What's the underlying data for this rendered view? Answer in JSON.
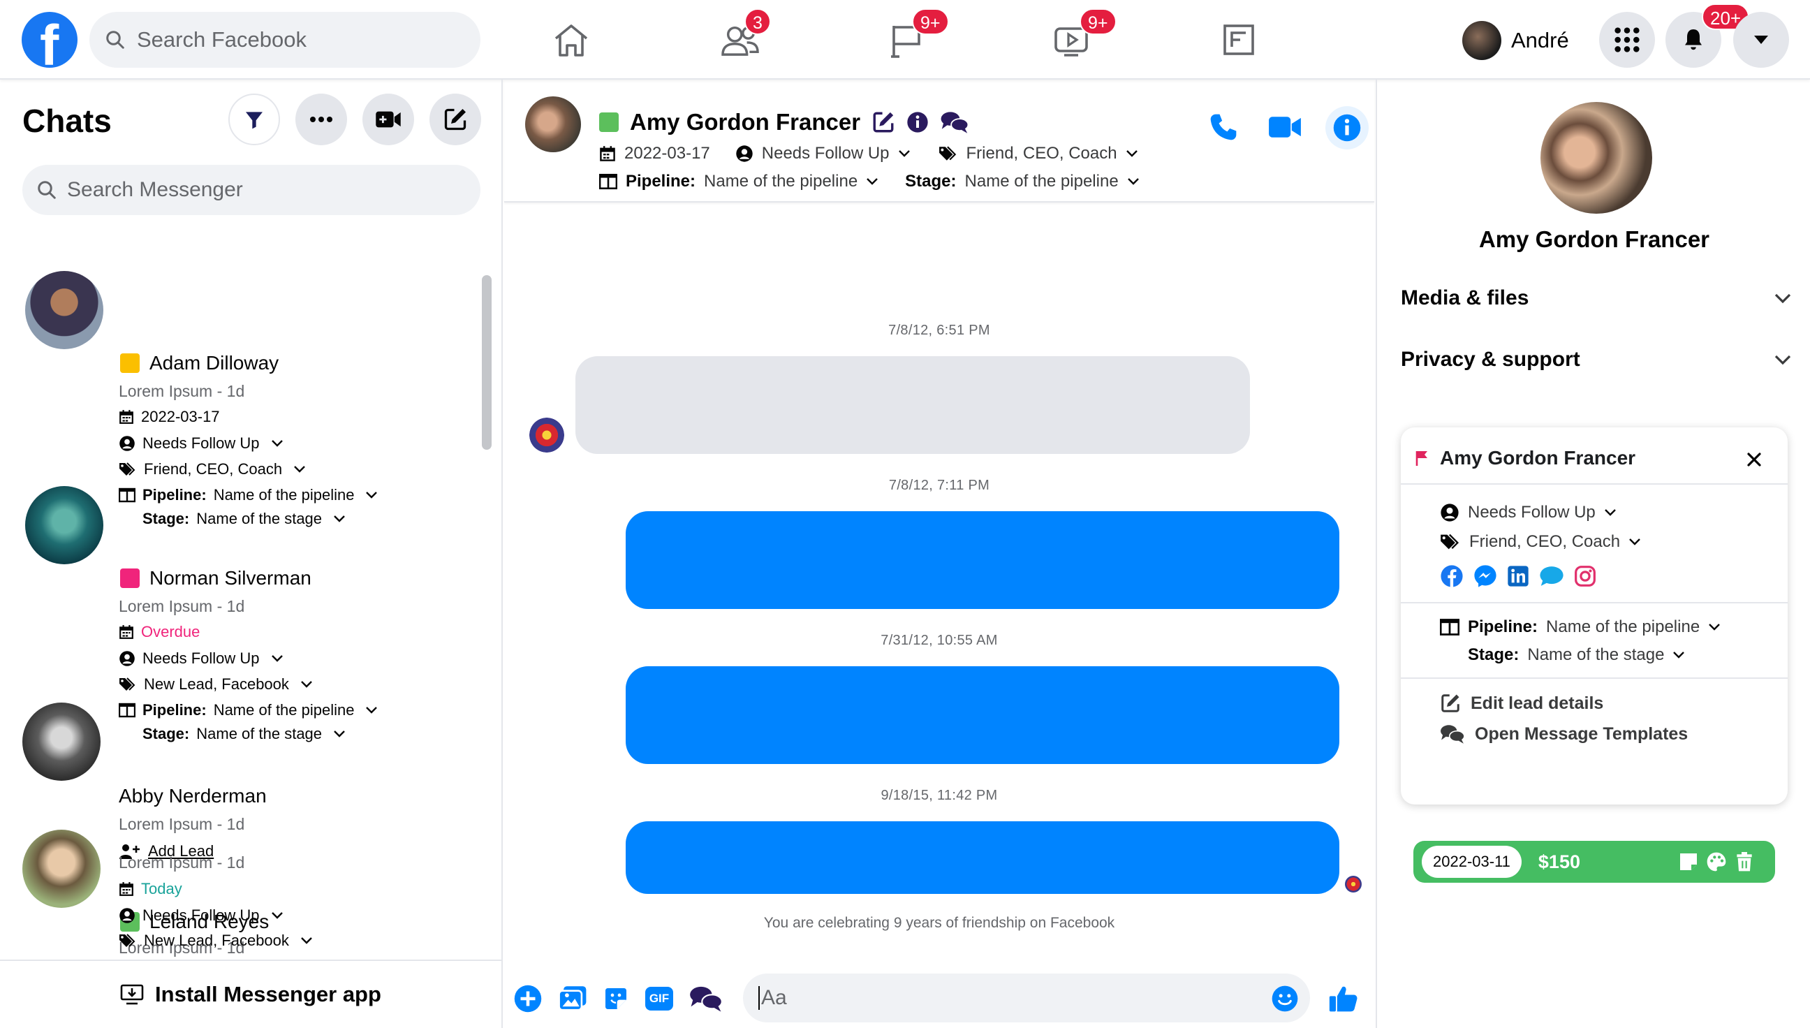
{
  "topbar": {
    "search_placeholder": "Search Facebook",
    "badges": {
      "friends": "3",
      "pages": "9+",
      "watch": "9+",
      "notifications": "20+"
    },
    "profile_name": "André"
  },
  "left": {
    "title": "Chats",
    "search_placeholder": "Search Messenger",
    "install_label": "Install Messenger app",
    "chats": [
      {
        "name": "Adam Dilloway",
        "color": "#fbbf00",
        "preview": "Lorem Ipsum - 1d",
        "date": "2022-03-17",
        "status": "Needs Follow Up",
        "tags": "Friend, CEO, Coach",
        "pipeline_label": "Pipeline:",
        "pipeline": "Name of the pipeline",
        "stage_label": "Stage:",
        "stage": "Name of the stage"
      },
      {
        "name": "Norman Silverman",
        "color": "#f0247b",
        "preview": "Lorem Ipsum - 1d",
        "date": "Overdue",
        "status": "Needs Follow Up",
        "tags": "New Lead, Facebook",
        "pipeline_label": "Pipeline:",
        "pipeline": "Name of the pipeline",
        "stage_label": "Stage:",
        "stage": "Name of the stage"
      },
      {
        "name": "Abby Nerderman",
        "preview": "Lorem Ipsum - 1d",
        "add_lead": "Add Lead"
      },
      {
        "name": "Leland Reyes",
        "color": "#5cbf5c",
        "preview": "Lorem Ipsum - 1d",
        "date": "Today",
        "status": "Needs Follow Up",
        "tags": "New Lead, Facebook"
      }
    ]
  },
  "conversation": {
    "name": "Amy Gordon Francer",
    "color": "#5cbf5c",
    "date": "2022-03-17",
    "status": "Needs Follow Up",
    "tags": "Friend, CEO, Coach",
    "pipeline_label": "Pipeline:",
    "pipeline": "Name of the pipeline",
    "stage_label": "Stage:",
    "stage": "Name of the pipeline",
    "timestamps": [
      "7/8/12, 6:51 PM",
      "7/8/12, 7:11 PM",
      "7/31/12, 10:55 AM",
      "9/18/15, 11:42 PM"
    ],
    "celebration": "You  are celebrating 9 years of friendship on Facebook",
    "composer_placeholder": "Aa",
    "gif_label": "GIF"
  },
  "right_panel": {
    "name": "Amy Gordon Francer",
    "sections": [
      "Media & files",
      "Privacy & support"
    ],
    "card": {
      "title": "Amy Gordon Francer",
      "status": "Needs Follow Up",
      "tags": "Friend, CEO, Coach",
      "pipeline_label": "Pipeline:",
      "pipeline": "Name of the pipeline",
      "stage_label": "Stage:",
      "stage": "Name of the stage",
      "edit_label": "Edit lead details",
      "templates_label": "Open Message Templates",
      "deal_date": "2022-03-11",
      "deal_amount": "$150"
    }
  },
  "colors": {
    "accent": "#0084ff",
    "fb_blue": "#1877f2",
    "badge_red": "#e41e3f",
    "deal_green": "#45bd62",
    "overdue": "#f0247b",
    "today": "#1aa39a"
  }
}
